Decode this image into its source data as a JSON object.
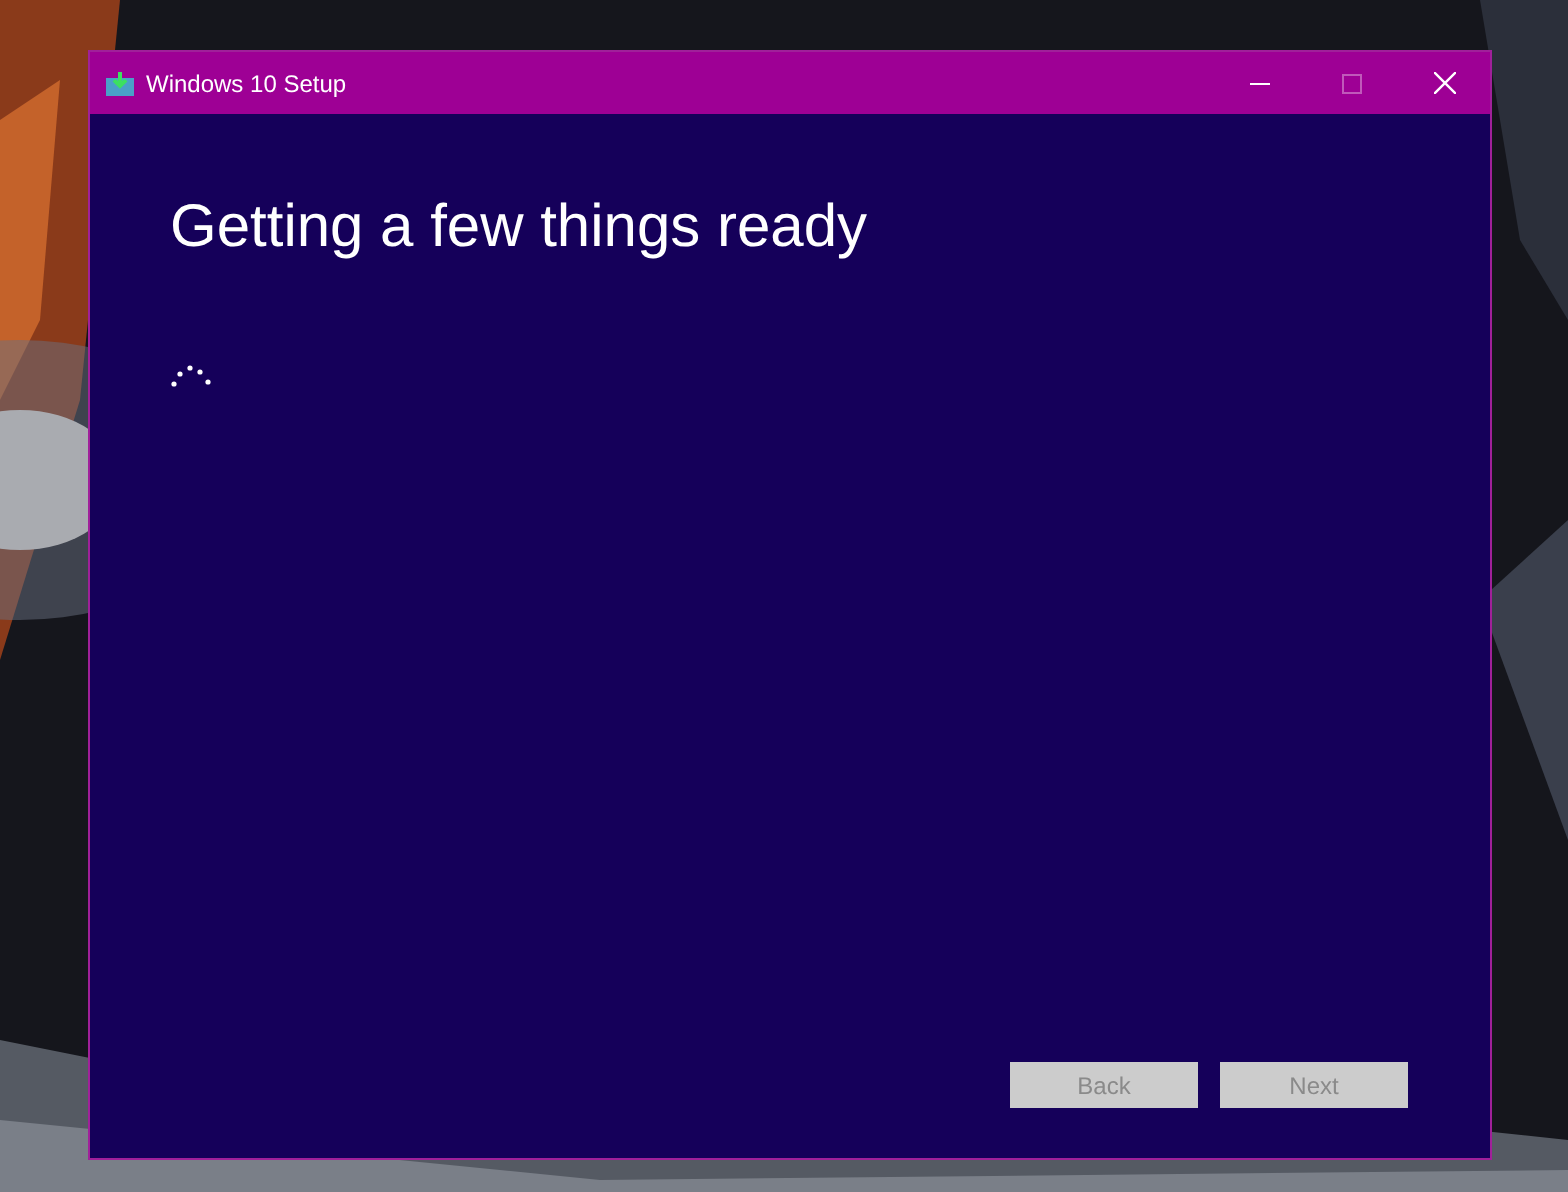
{
  "window": {
    "title": "Windows 10 Setup",
    "maximize_disabled": true
  },
  "heading": "Getting a few things ready",
  "buttons": [
    {
      "label": "Back",
      "disabled": true
    },
    {
      "label": "Next",
      "disabled": true
    }
  ]
}
